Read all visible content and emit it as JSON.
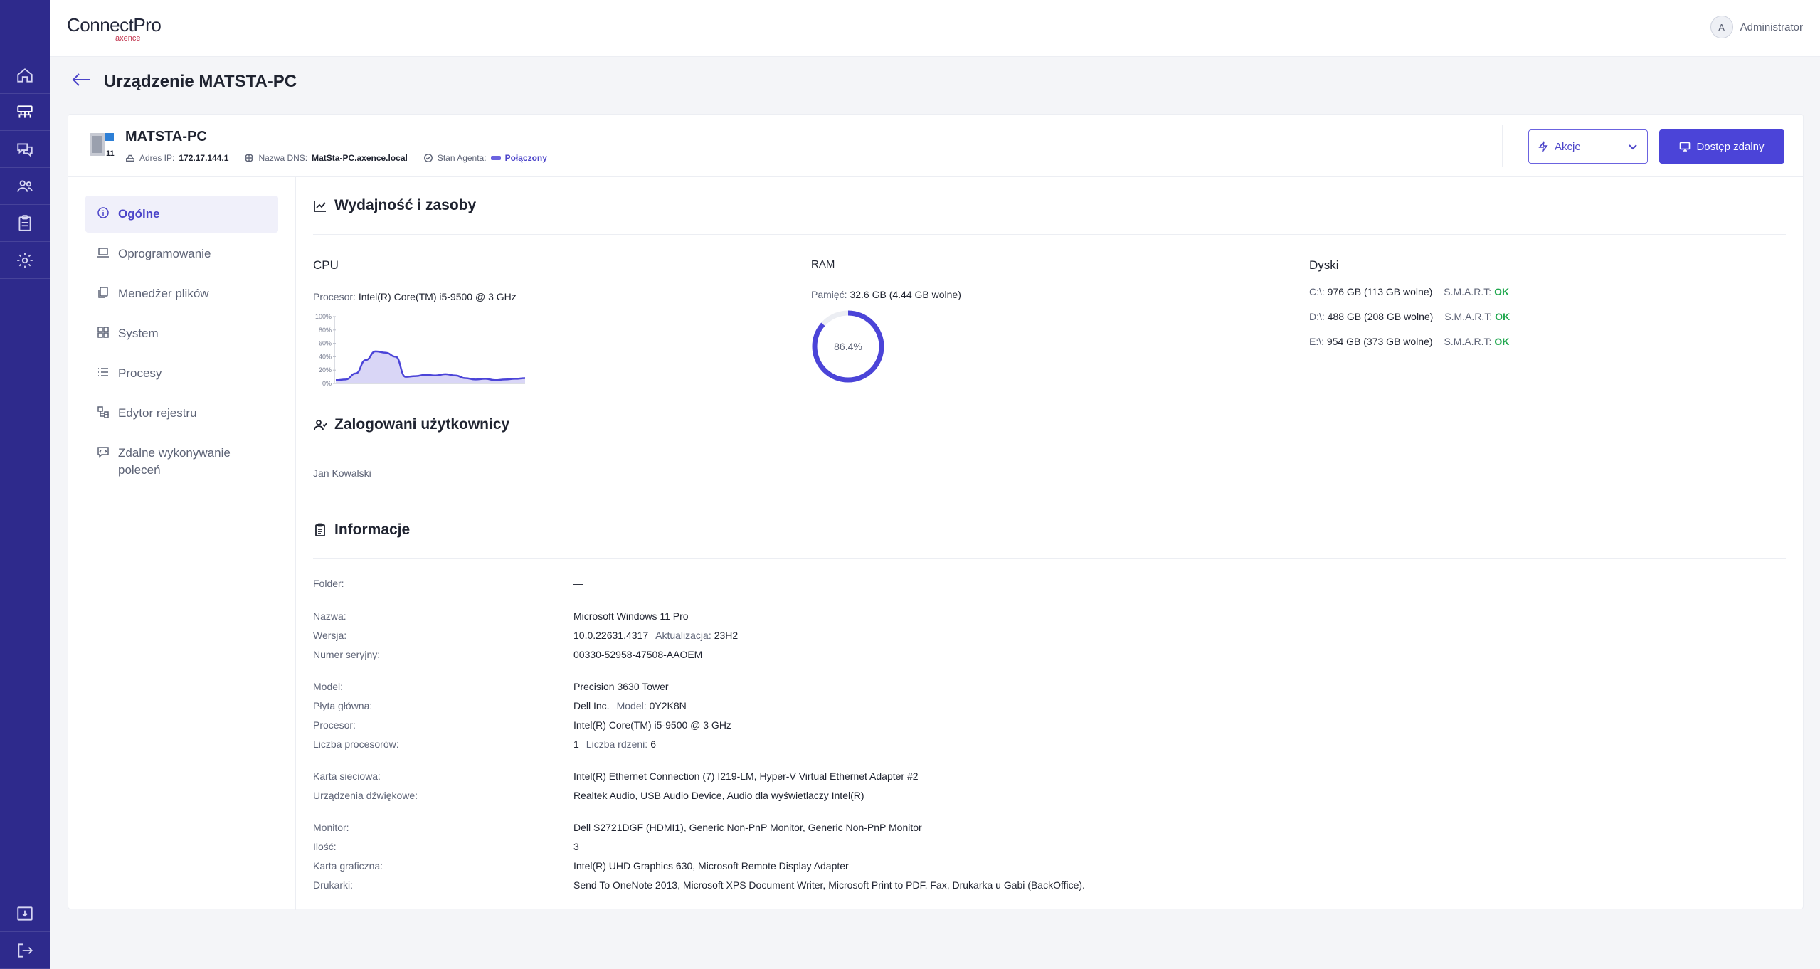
{
  "app": {
    "logo": "ConnectPro",
    "logo_sub": "axence",
    "user_initial": "A",
    "user_name": "Administrator"
  },
  "page": {
    "title": "Urządzenie MATSTA-PC"
  },
  "device": {
    "name": "MATSTA-PC",
    "ip_label": "Adres IP:",
    "ip": "172.17.144.1",
    "dns_label": "Nazwa DNS:",
    "dns": "MatSta-PC.axence.local",
    "agent_label": "Stan Agenta:",
    "agent_status": "Połączony",
    "os_badge": "11"
  },
  "toolbar": {
    "actions_label": "Akcje",
    "remote_label": "Dostęp zdalny"
  },
  "nav": {
    "items": [
      {
        "label": "Ogólne",
        "icon": "info-icon"
      },
      {
        "label": "Oprogramowanie",
        "icon": "laptop-icon"
      },
      {
        "label": "Menedżer plików",
        "icon": "files-icon"
      },
      {
        "label": "System",
        "icon": "windows-icon"
      },
      {
        "label": "Procesy",
        "icon": "list-icon"
      },
      {
        "label": "Edytor rejestru",
        "icon": "registry-icon"
      },
      {
        "label": "Zdalne wykonywanie poleceń",
        "icon": "command-icon"
      }
    ],
    "active": 0
  },
  "performance": {
    "title": "Wydajność i zasoby",
    "cpu": {
      "title": "CPU",
      "label": "Procesor:",
      "value": "Intel(R) Core(TM) i5-9500 @ 3 GHz"
    },
    "ram": {
      "title": "RAM",
      "label": "Pamięć:",
      "value": "32.6 GB (4.44 GB wolne)",
      "usage_text": "86.4%",
      "usage_fraction": 0.864
    },
    "disks": {
      "title": "Dyski",
      "smart_label": "S.M.A.R.T:",
      "items": [
        {
          "drive": "C:\\:",
          "value": "976 GB (113 GB wolne)",
          "status": "OK"
        },
        {
          "drive": "D:\\:",
          "value": "488 GB (208 GB wolne)",
          "status": "OK"
        },
        {
          "drive": "E:\\:",
          "value": "954 GB (373 GB wolne)",
          "status": "OK"
        }
      ]
    }
  },
  "chart_data": {
    "type": "area",
    "y_ticks": [
      "100%",
      "80%",
      "60%",
      "40%",
      "20%",
      "0%"
    ],
    "ylim": [
      0,
      100
    ],
    "values": [
      5,
      6,
      15,
      35,
      48,
      46,
      40,
      10,
      11,
      13,
      12,
      14,
      12,
      8,
      6,
      7,
      5,
      6,
      7,
      8
    ],
    "color": "#4b44d8",
    "fill": "#d9d6f6"
  },
  "users": {
    "title": "Zalogowani użytkownicy",
    "list": [
      "Jan Kowalski"
    ]
  },
  "info": {
    "title": "Informacje",
    "folder_label": "Folder:",
    "folder": "—",
    "name_label": "Nazwa:",
    "name": "Microsoft Windows 11 Pro",
    "version_label": "Wersja:",
    "version": "10.0.22631.4317",
    "update_label": "Aktualizacja:",
    "update": "23H2",
    "serial_label": "Numer seryjny:",
    "serial": "00330-52958-47508-AAOEM",
    "model_label": "Model:",
    "model": "Precision 3630 Tower",
    "board_label": "Płyta główna:",
    "board": "Dell Inc.",
    "board_model_label": "Model:",
    "board_model": "0Y2K8N",
    "cpu_label": "Procesor:",
    "cpu": "Intel(R) Core(TM) i5-9500 @ 3 GHz",
    "cpu_count_label": "Liczba procesorów:",
    "cpu_count": "1",
    "cores_label": "Liczba rdzeni:",
    "cores": "6",
    "nic_label": "Karta sieciowa:",
    "nic": "Intel(R) Ethernet Connection (7) I219-LM, Hyper-V Virtual Ethernet Adapter #2",
    "audio_label": "Urządzenia dźwiękowe:",
    "audio": "Realtek Audio, USB Audio Device, Audio dla wyświetlaczy Intel(R)",
    "monitor_label": "Monitor:",
    "monitor": "Dell S2721DGF (HDMI1), Generic Non-PnP Monitor, Generic Non-PnP Monitor",
    "qty_label": "Ilość:",
    "qty": "3",
    "gpu_label": "Karta graficzna:",
    "gpu": "Intel(R) UHD Graphics 630, Microsoft Remote Display Adapter",
    "printers_label": "Drukarki:",
    "printers": "Send To OneNote 2013, Microsoft XPS Document Writer, Microsoft Print to PDF, Fax, Drukarka u Gabi (BackOffice)."
  }
}
